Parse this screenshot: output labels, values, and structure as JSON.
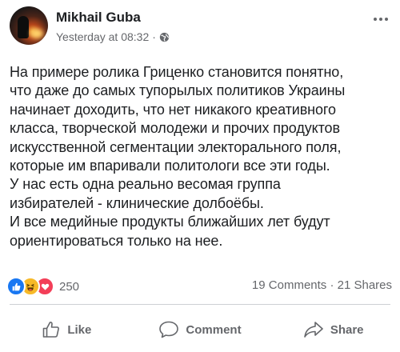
{
  "post": {
    "author": "Mikhail Guba",
    "timestamp": "Yesterday at 08:32",
    "separator": "·",
    "audience_icon": "globe-icon",
    "more_icon": "more-options-icon",
    "text": "На примере ролика Гриценко становится понятно,\nчто даже до самых тупорылых политиков Украины\nначинает доходить, что нет никакого креативного\nкласса, творческой молодежи и прочих продуктов\nискусственной сегментации электорального поля,\nкоторые им впаривали политологи все эти годы.\nУ нас есть одна реально весомая группа\nизбирателей - клинические долбоёбы.\nИ все медийные продукты ближайших лет будут\nориентироваться только на нее."
  },
  "stats": {
    "reaction_icons": [
      "like-reaction-icon",
      "haha-reaction-icon",
      "love-reaction-icon"
    ],
    "reaction_count": "250",
    "comments_shares": "19 Comments · 21 Shares"
  },
  "actions": {
    "like_label": "Like",
    "comment_label": "Comment",
    "share_label": "Share"
  },
  "colors": {
    "like_blue": "#1877f2",
    "haha_yellow": "#f7b928",
    "love_red": "#f33e58",
    "secondary_text": "#65676b"
  }
}
